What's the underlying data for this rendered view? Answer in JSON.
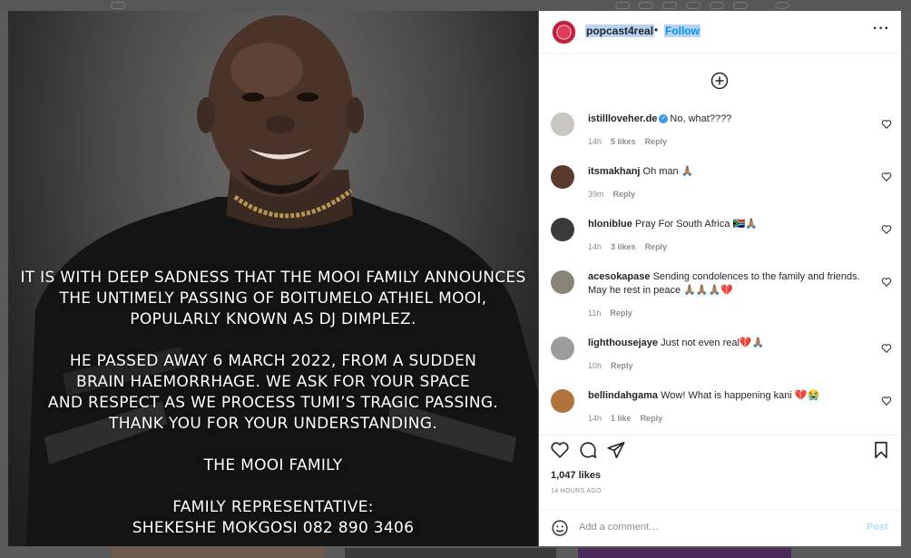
{
  "post": {
    "image": {
      "lines_1": [
        "IT IS WITH DEEP SADNESS THAT THE MOOI FAMILY ANNOUNCES",
        "THE UNTIMELY PASSING OF BOITUMELO ATHIEL MOOI,",
        "POPULARLY KNOWN AS DJ DIMPLEZ."
      ],
      "lines_2": [
        "HE PASSED AWAY 6 MARCH 2022,  FROM A SUDDEN",
        "BRAIN HAEMORRHAGE. WE ASK FOR YOUR SPACE",
        "AND RESPECT AS WE PROCESS TUMI’S TRAGIC PASSING.",
        "THANK YOU FOR YOUR UNDERSTANDING."
      ],
      "signature": "THE MOOI FAMILY",
      "rep_title": "FAMILY REPRESENTATIVE:",
      "rep_contact": "SHEKESHE MOKGOSI 082 890 3406"
    },
    "header": {
      "username": "popcast4real",
      "dot": "•",
      "follow": "Follow",
      "more": "···"
    },
    "comments": [
      {
        "user": "istillloveher.de",
        "verified": true,
        "text": "No, what????",
        "time": "14h",
        "likes": "5 likes",
        "reply": "Reply",
        "avatar_color": "#c9c6c2"
      },
      {
        "user": "itsmakhanj",
        "verified": false,
        "text": "Oh man 🙏🏽",
        "time": "39m",
        "likes": "",
        "reply": "Reply",
        "avatar_color": "#5a3a2a"
      },
      {
        "user": "hlonibluе",
        "verified": false,
        "text": "Pray For South Africa 🇿🇦🙏🏽",
        "time": "14h",
        "likes": "3 likes",
        "reply": "Reply",
        "avatar_color": "#3a3a3a"
      },
      {
        "user": "acesokapase",
        "verified": false,
        "text": "Sending condolences to the family and friends. May he rest in peace 🙏🏽🙏🏽🙏🏽💔",
        "time": "11h",
        "likes": "",
        "reply": "Reply",
        "avatar_color": "#8a8378"
      },
      {
        "user": "lighthousejaye",
        "verified": false,
        "text": "Just not even real💔🙏🏽",
        "time": "10h",
        "likes": "",
        "reply": "Reply",
        "avatar_color": "#9c9c9c"
      },
      {
        "user": "bellindahgama",
        "verified": false,
        "text": "Wow! What is happening kani 💔😭",
        "time": "14h",
        "likes": "1 like",
        "reply": "Reply",
        "avatar_color": "#b0743a"
      }
    ],
    "likes": "1,047 likes",
    "time_ago": "14 HOURS AGO",
    "add_comment_placeholder": "Add a comment…",
    "post_button": "Post"
  },
  "colors": {
    "link": "#0095f6",
    "text": "#262626",
    "muted": "#8e8e8e",
    "post_disabled": "#b2dffc"
  }
}
